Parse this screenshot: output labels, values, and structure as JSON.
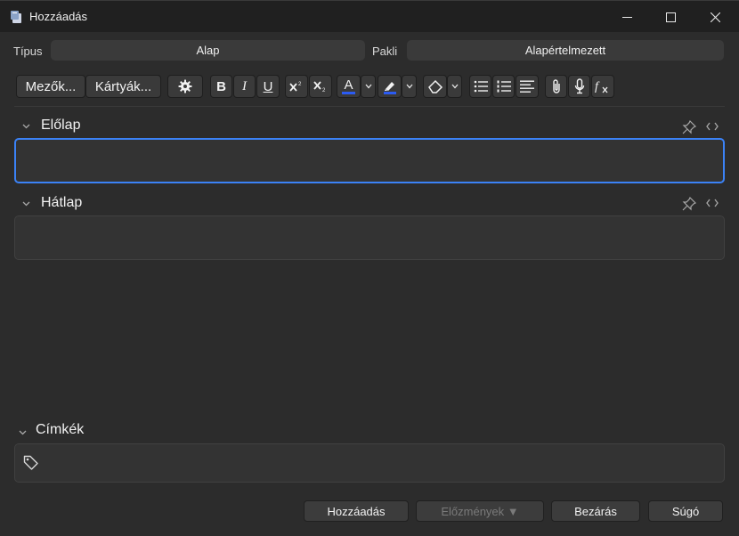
{
  "window": {
    "title": "Hozzáadás"
  },
  "top": {
    "type_label": "Típus",
    "type_value": "Alap",
    "deck_label": "Pakli",
    "deck_value": "Alapértelmezett"
  },
  "toolbar": {
    "fields_label": "Mezők...",
    "cards_label": "Kártyák...",
    "bold_label": "B",
    "italic_label": "I",
    "underline_label": "U",
    "text_color_label": "A",
    "color_accent": "#2b5bf2"
  },
  "fields": [
    {
      "label": "Előlap",
      "value": ""
    },
    {
      "label": "Hátlap",
      "value": ""
    }
  ],
  "tags": {
    "label": "Címkék",
    "value": ""
  },
  "buttons": {
    "add": "Hozzáadás",
    "history": "Előzmények ▼",
    "close": "Bezárás",
    "help": "Súgó"
  },
  "colors": {
    "focus": "#3b82f6",
    "panel": "#2c2c2c",
    "input": "#333333"
  },
  "icons": [
    "app-icon",
    "minimize-icon",
    "maximize-icon",
    "close-icon",
    "gear-icon",
    "superscript-icon",
    "subscript-icon",
    "highlight-icon",
    "eraser-icon",
    "bullet-list-icon",
    "numbered-list-icon",
    "align-icon",
    "attachment-icon",
    "microphone-icon",
    "formula-icon",
    "pin-icon",
    "code-icon",
    "tag-icon",
    "chevron-down-icon"
  ]
}
